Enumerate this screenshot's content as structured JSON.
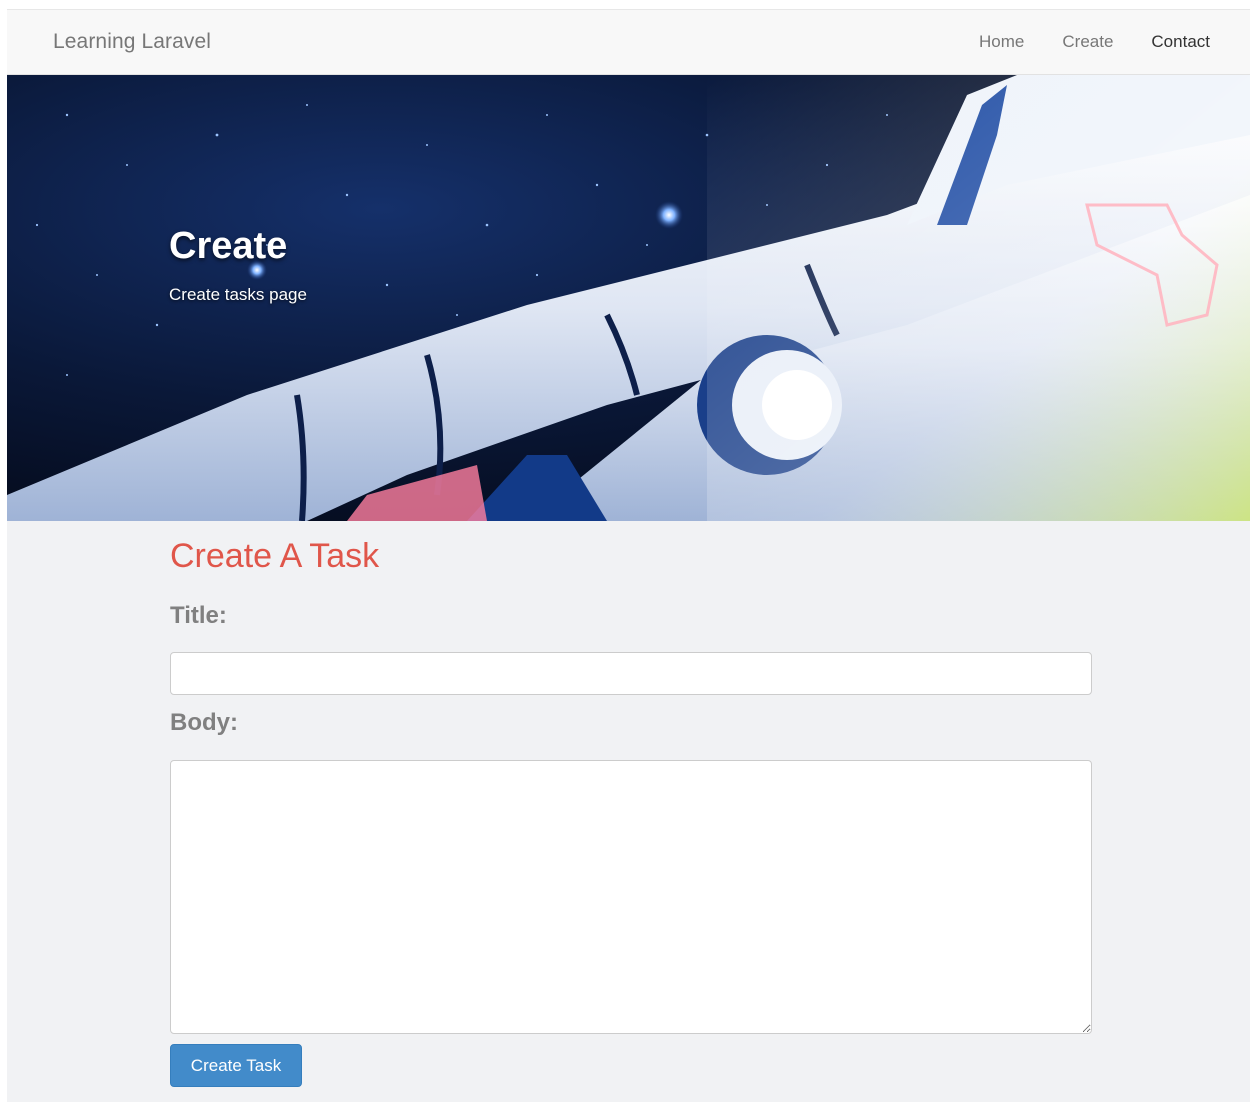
{
  "navbar": {
    "brand": "Learning Laravel",
    "links": [
      {
        "label": "Home"
      },
      {
        "label": "Create"
      },
      {
        "label": "Contact"
      }
    ]
  },
  "hero": {
    "title": "Create",
    "subtitle": "Create tasks page"
  },
  "form": {
    "heading": "Create A Task",
    "title_label": "Title:",
    "title_value": "",
    "body_label": "Body:",
    "body_value": "",
    "submit_label": "Create Task"
  },
  "colors": {
    "accent": "#e0564a",
    "button": "#428bca",
    "page_bg": "#f1f2f4",
    "navbar_bg": "#f8f8f8"
  }
}
